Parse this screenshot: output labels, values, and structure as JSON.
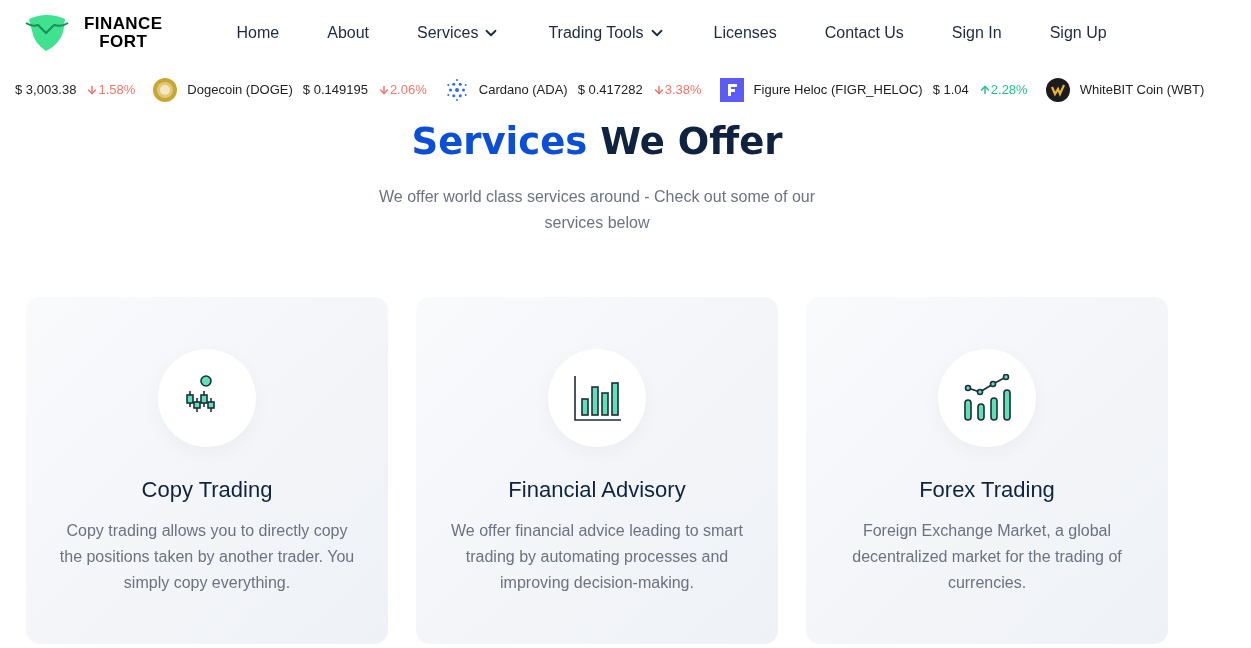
{
  "brand": {
    "line1": "FINANCE",
    "line2": "FORT"
  },
  "nav": [
    {
      "label": "Home",
      "dropdown": false
    },
    {
      "label": "About",
      "dropdown": false
    },
    {
      "label": "Services",
      "dropdown": true
    },
    {
      "label": "Trading Tools",
      "dropdown": true
    },
    {
      "label": "Licenses",
      "dropdown": false
    },
    {
      "label": "Contact Us",
      "dropdown": false
    },
    {
      "label": "Sign In",
      "dropdown": false
    },
    {
      "label": "Sign Up",
      "dropdown": false
    }
  ],
  "ticker": [
    {
      "kind": "plain",
      "price": "$ 3,003.38",
      "change": "1.58%",
      "rising": false
    },
    {
      "kind": "doge",
      "name": "Dogecoin (DOGE)",
      "price": "$ 0.149195",
      "change": "2.06%",
      "rising": false
    },
    {
      "kind": "cardano",
      "name": "Cardano (ADA)",
      "price": "$ 0.417282",
      "change": "3.38%",
      "rising": false
    },
    {
      "kind": "figure",
      "name": "Figure Heloc (FIGR_HELOC)",
      "price": "$ 1.04",
      "change": "2.28%",
      "rising": true
    },
    {
      "kind": "wbt",
      "name": "WhiteBIT Coin (WBT)"
    }
  ],
  "heading": {
    "accent": "Services",
    "rest": "We Offer"
  },
  "subtitle": "We offer world class services around - Check out some of our services below",
  "services": [
    {
      "kind": "candles",
      "title": "Copy Trading",
      "text": "Copy trading allows you to directly copy the positions taken by another trader. You simply copy everything."
    },
    {
      "kind": "bars",
      "title": "Financial Advisory",
      "text": "We offer financial advice leading to smart trading by automating processes and improving decision-making."
    },
    {
      "kind": "growth",
      "title": "Forex Trading",
      "text": "Foreign Exchange Market, a global decentralized market for the trading of currencies."
    }
  ]
}
